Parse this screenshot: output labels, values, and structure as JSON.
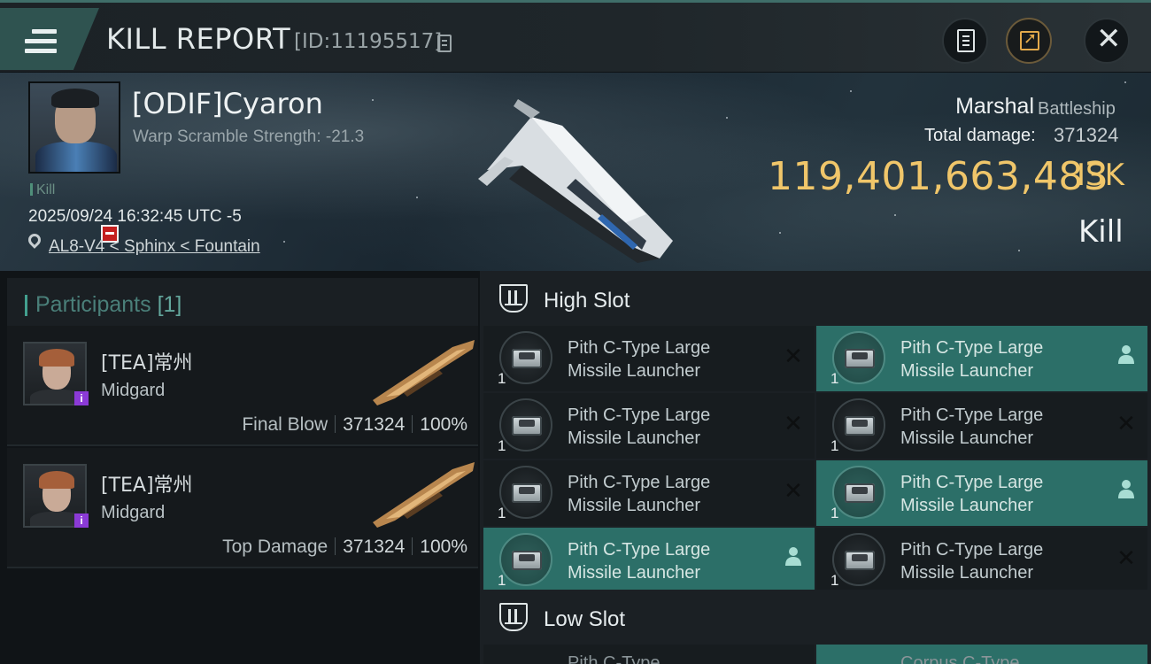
{
  "header": {
    "title": "KILL REPORT",
    "report_id": "[ID:11195517]"
  },
  "victim": {
    "name": "[ODIF]Cyaron",
    "warp_scramble": "Warp Scramble Strength: -21.3",
    "tag": "Kill",
    "timestamp": "2025/09/24 16:32:45 UTC -5",
    "location": "AL8-V4 < Sphinx < Fountain",
    "ship_name": "Marshal",
    "ship_class": "Battleship",
    "total_damage_label": "Total damage:",
    "total_damage": "371324",
    "isk_value": "119,401,663,483",
    "isk_unit": "ISK",
    "result": "Kill"
  },
  "participants": {
    "title": "Participants",
    "count": "[1]",
    "rows": [
      {
        "name": "[TEA]常州",
        "ship": "Midgard",
        "role": "Final Blow",
        "damage": "371324",
        "percent": "100%"
      },
      {
        "name": "[TEA]常州",
        "ship": "Midgard",
        "role": "Top Damage",
        "damage": "371324",
        "percent": "100%"
      }
    ]
  },
  "fittings": {
    "high_slot_title": "High Slot",
    "low_slot_title": "Low Slot",
    "modules": [
      {
        "line1": "Pith C-Type Large",
        "line2": "Missile Launcher",
        "qty": "1",
        "status": "destroyed"
      },
      {
        "line1": "Pith C-Type Large",
        "line2": "Missile Launcher",
        "qty": "1",
        "status": "dropped"
      },
      {
        "line1": "Pith C-Type Large",
        "line2": "Missile Launcher",
        "qty": "1",
        "status": "destroyed"
      },
      {
        "line1": "Pith C-Type Large",
        "line2": "Missile Launcher",
        "qty": "1",
        "status": "destroyed"
      },
      {
        "line1": "Pith C-Type Large",
        "line2": "Missile Launcher",
        "qty": "1",
        "status": "destroyed"
      },
      {
        "line1": "Pith C-Type Large",
        "line2": "Missile Launcher",
        "qty": "1",
        "status": "dropped"
      },
      {
        "line1": "Pith C-Type Large",
        "line2": "Missile Launcher",
        "qty": "1",
        "status": "dropped"
      },
      {
        "line1": "Pith C-Type Large",
        "line2": "Missile Launcher",
        "qty": "1",
        "status": "destroyed"
      }
    ],
    "low_peek": [
      "Pith C-Type",
      "Corpus C-Type"
    ]
  },
  "icons": {
    "menu": "menu-icon",
    "copy": "copy-icon",
    "clipboard": "clipboard-icon",
    "share": "share-icon",
    "close": "close-icon",
    "location": "location-pin-icon",
    "slot": "slot-icon",
    "destroyed": "x-icon",
    "dropped": "person-icon"
  },
  "colors": {
    "accent_teal": "#2c6f68",
    "isk_gold": "#f0c66a",
    "kill_badge": "#c41f1f",
    "participant_badge": "#8b3ad6"
  }
}
